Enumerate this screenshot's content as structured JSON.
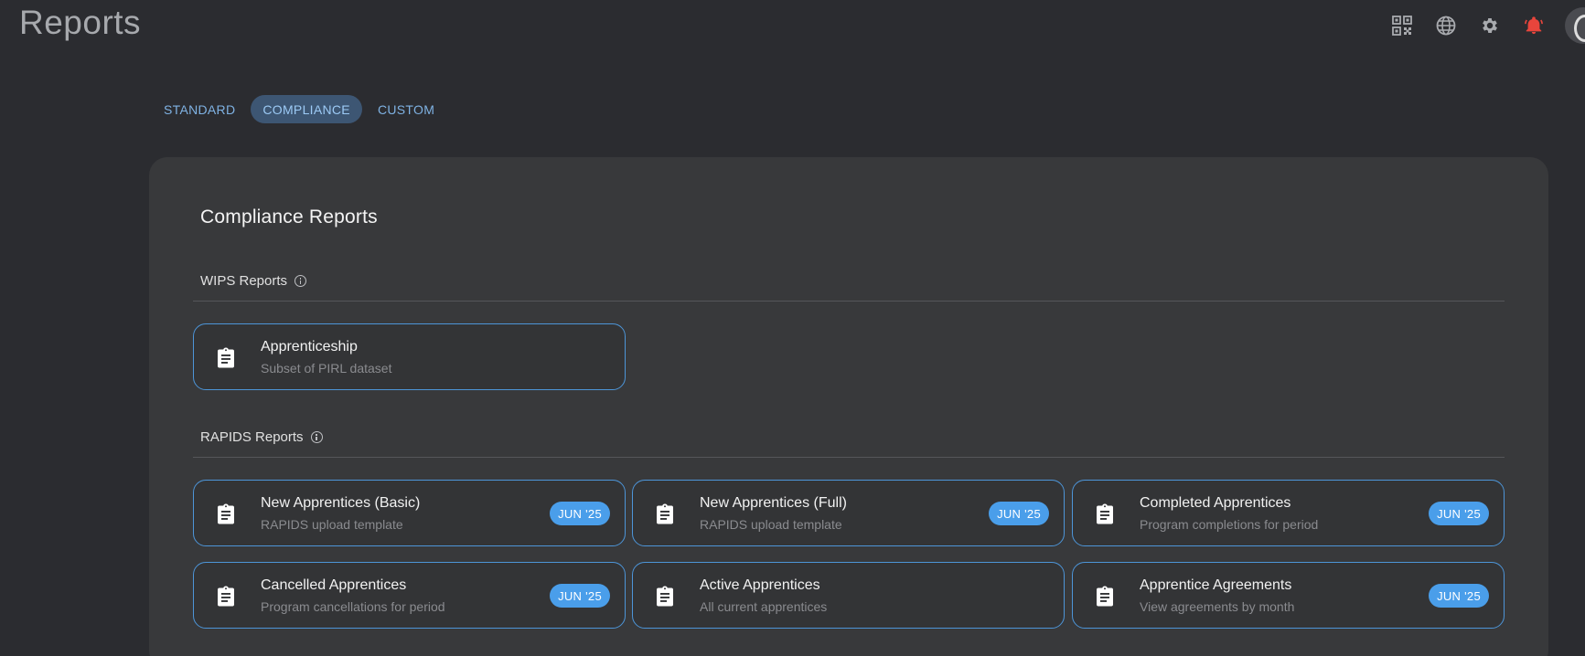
{
  "page": {
    "title": "Reports"
  },
  "header": {
    "icons": [
      "qr-code-icon",
      "globe-icon",
      "gear-icon",
      "bell-icon"
    ],
    "bell_color": "#e8453c"
  },
  "tabs": [
    {
      "label": "STANDARD",
      "active": false
    },
    {
      "label": "COMPLIANCE",
      "active": true
    },
    {
      "label": "CUSTOM",
      "active": false
    }
  ],
  "panel": {
    "title": "Compliance Reports",
    "sections": [
      {
        "label": "WIPS Reports",
        "cards": [
          {
            "title": "Apprenticeship",
            "subtitle": "Subset of PIRL dataset",
            "badge": ""
          }
        ]
      },
      {
        "label": "RAPIDS Reports",
        "cards": [
          {
            "title": "New Apprentices (Basic)",
            "subtitle": "RAPIDS upload template",
            "badge": "JUN '25"
          },
          {
            "title": "New Apprentices (Full)",
            "subtitle": "RAPIDS upload template",
            "badge": "JUN '25"
          },
          {
            "title": "Completed Apprentices",
            "subtitle": "Program completions for period",
            "badge": "JUN '25"
          },
          {
            "title": "Cancelled Apprentices",
            "subtitle": "Program cancellations for period",
            "badge": "JUN '25"
          },
          {
            "title": "Active Apprentices",
            "subtitle": "All current apprentices",
            "badge": ""
          },
          {
            "title": "Apprentice Agreements",
            "subtitle": "View agreements by month",
            "badge": "JUN '25"
          }
        ]
      }
    ]
  },
  "colors": {
    "background": "#2b2c30",
    "panel": "#38393b",
    "card_border": "#4d95d8",
    "badge": "#4a9eea",
    "tab_active_bg": "#3d5673",
    "tab_text": "#7fb2e3"
  }
}
